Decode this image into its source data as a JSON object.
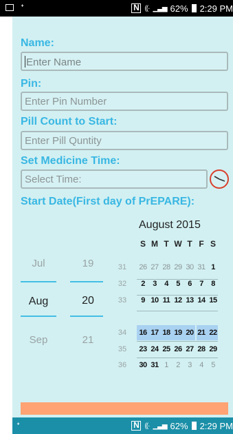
{
  "status_bar": {
    "left_icons": [
      "screenshot-icon",
      "missed-call-icon"
    ],
    "battery": "62%",
    "time": "2:29 PM"
  },
  "nav_bar": {
    "battery": "62%",
    "time": "2:29 PM"
  },
  "form": {
    "name_label": "Name:",
    "name_placeholder": "Enter Name",
    "pin_label": "Pin:",
    "pin_placeholder": "Enter Pin Number",
    "pill_label": "Pill Count to Start:",
    "pill_placeholder": "Enter Pill Quntity",
    "time_label": "Set Medicine Time:",
    "time_placeholder": "Select Time:",
    "start_label": "Start Date(First day of PrEPARE):"
  },
  "date_picker": {
    "months": [
      "Jul",
      "Aug",
      "Sep"
    ],
    "days": [
      "19",
      "20",
      "21"
    ],
    "selected_month": "Aug",
    "selected_day": "20"
  },
  "calendar": {
    "title": "August 2015",
    "weekday_headers": [
      "S",
      "M",
      "T",
      "W",
      "T",
      "F",
      "S"
    ],
    "weeks": [
      {
        "num": "31",
        "days": [
          "26",
          "27",
          "28",
          "29",
          "30",
          "31",
          "1"
        ]
      },
      {
        "num": "32",
        "days": [
          "2",
          "3",
          "4",
          "5",
          "6",
          "7",
          "8"
        ]
      },
      {
        "num": "33",
        "days": [
          "9",
          "10",
          "11",
          "12",
          "13",
          "14",
          "15"
        ]
      },
      {
        "num": "34",
        "days": [
          "16",
          "17",
          "18",
          "19",
          "20",
          "21",
          "22"
        ]
      },
      {
        "num": "35",
        "days": [
          "23",
          "24",
          "25",
          "26",
          "27",
          "28",
          "29"
        ]
      },
      {
        "num": "36",
        "days": [
          "30",
          "31",
          "1",
          "2",
          "3",
          "4",
          "5"
        ]
      }
    ],
    "selected_week": "34",
    "selected_day": "20"
  },
  "colors": {
    "accent": "#39b7e3",
    "background": "#d2f0f2",
    "week_highlight": "#a9d1f1",
    "action_bar": "#ffa374",
    "clock_ring": "#d9402d"
  }
}
